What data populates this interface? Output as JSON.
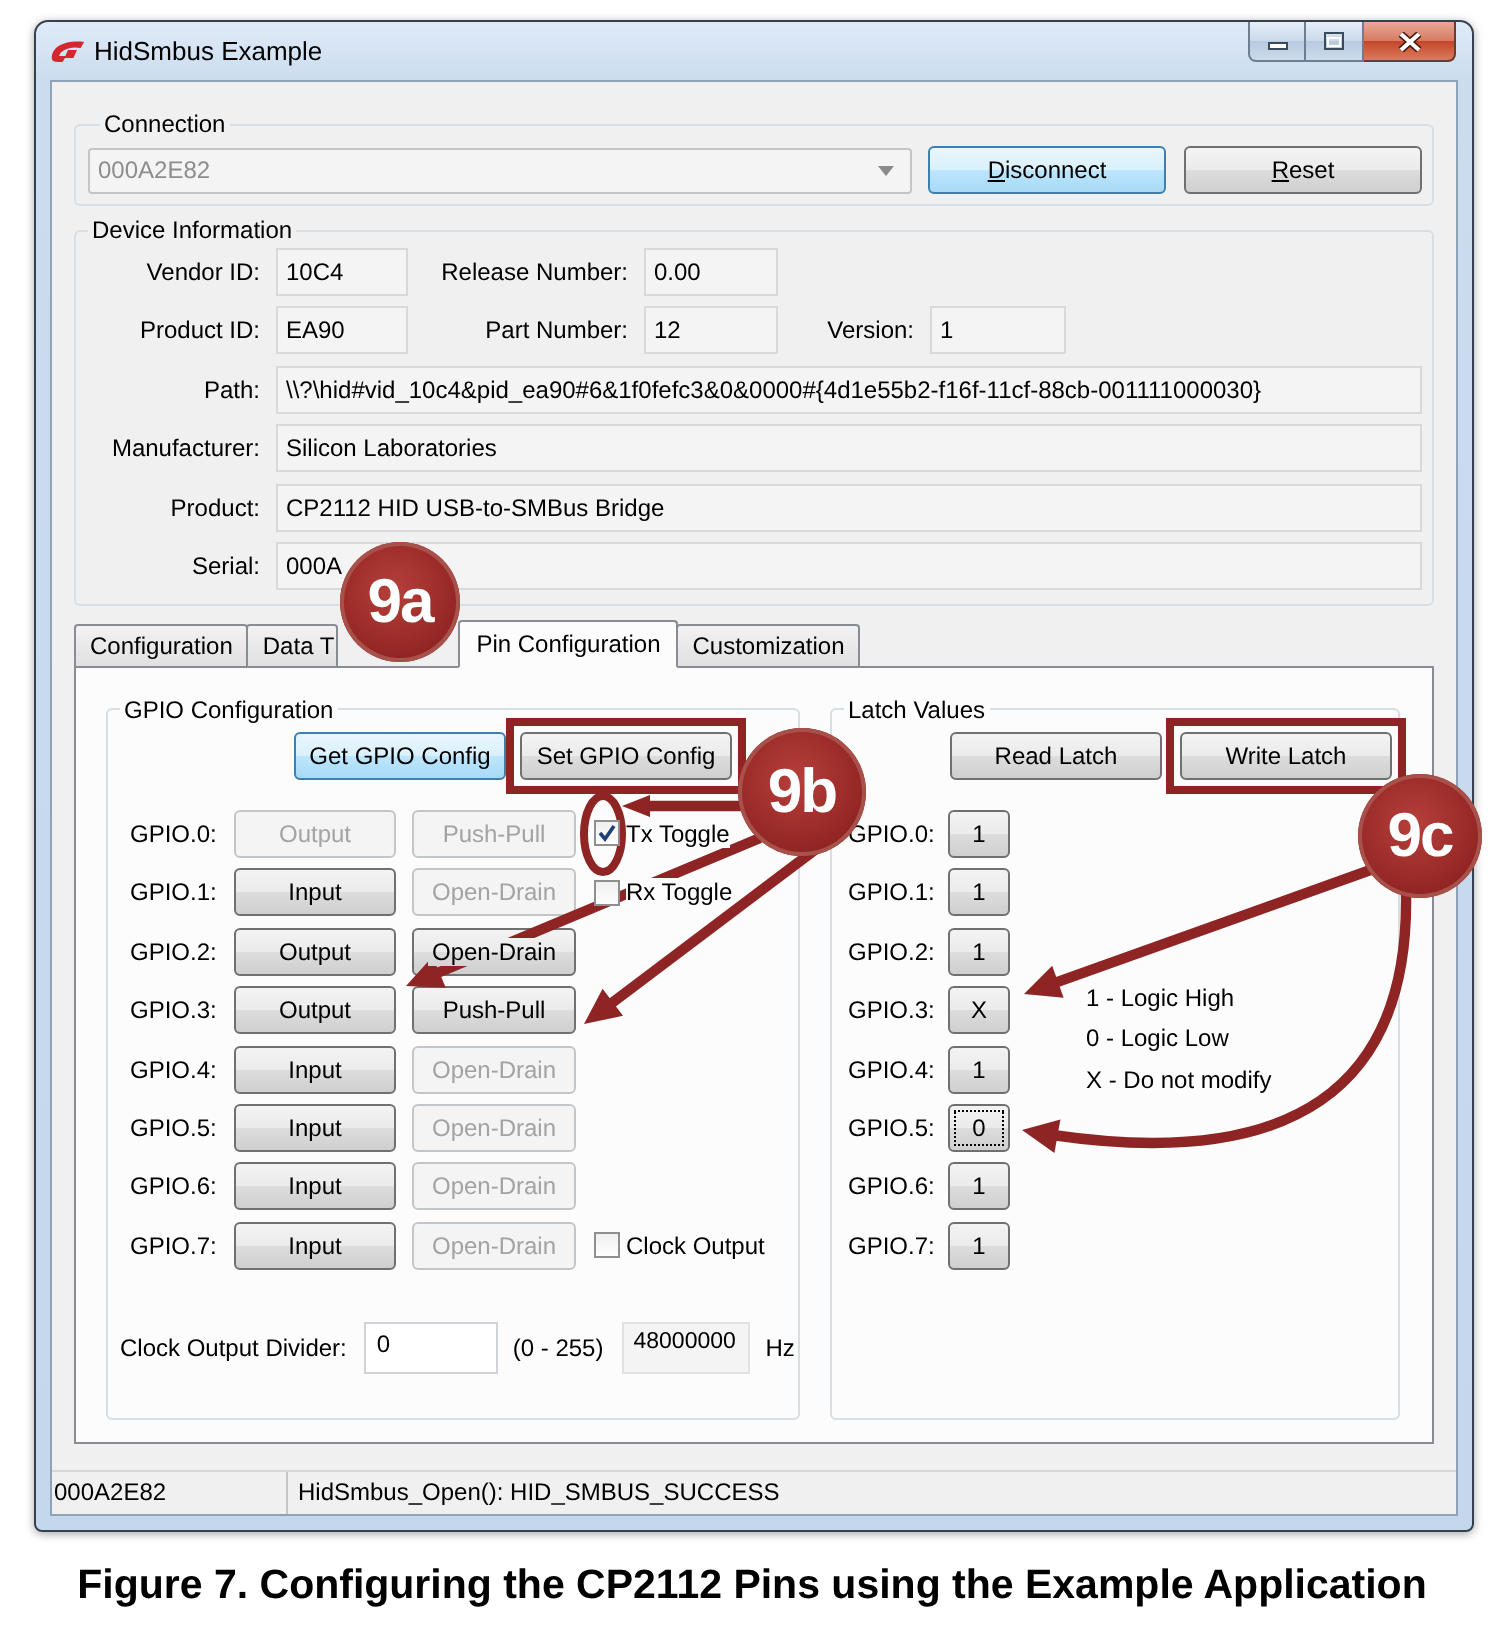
{
  "window": {
    "title": "HidSmbus Example"
  },
  "connection": {
    "title": "Connection",
    "device": {
      "value": "000A2E82",
      "disabled": true
    },
    "buttons": [
      {
        "label": "Disconnect",
        "focused": true
      },
      {
        "label": "Reset",
        "focused": false
      }
    ]
  },
  "device_info": {
    "title": "Device Information",
    "rows": [
      [
        {
          "label": "Vendor ID:",
          "value": "10C4"
        },
        {
          "label": "Release Number:",
          "value": "0.00"
        }
      ],
      [
        {
          "label": "Product ID:",
          "value": "EA90"
        },
        {
          "label": "Part Number:",
          "value": "12"
        },
        {
          "label": "Version:",
          "value": "1"
        }
      ],
      [
        {
          "label": "Path:",
          "value": "\\\\?\\hid#vid_10c4&pid_ea90#6&1f0fefc3&0&0000#{4d1e55b2-f16f-11cf-88cb-001111000030}"
        }
      ],
      [
        {
          "label": "Manufacturer:",
          "value": "Silicon Laboratories"
        }
      ],
      [
        {
          "label": "Product:",
          "value": "CP2112 HID USB-to-SMBus Bridge"
        }
      ],
      [
        {
          "label": "Serial:",
          "value": "000A"
        }
      ]
    ]
  },
  "tabs": [
    {
      "label": "Configuration",
      "selected": false
    },
    {
      "label": "Data T",
      "selected": false
    },
    {
      "label": "Pin Configuration",
      "selected": true
    },
    {
      "label": "Customization",
      "selected": false
    }
  ],
  "gpio_config": {
    "title": "GPIO Configuration",
    "buttons": [
      {
        "label": "Get GPIO Config",
        "focused": true,
        "highlighted": false
      },
      {
        "label": "Set GPIO Config",
        "focused": false,
        "highlighted": true
      }
    ],
    "pins": [
      {
        "label": "GPIO.0:",
        "direction": {
          "label": "Output",
          "disabled": true
        },
        "mode": {
          "label": "Push-Pull",
          "disabled": true
        },
        "option": {
          "label": "Tx Toggle",
          "checked": true,
          "circled": true
        }
      },
      {
        "label": "GPIO.1:",
        "direction": {
          "label": "Input",
          "disabled": false
        },
        "mode": {
          "label": "Open-Drain",
          "disabled": true
        },
        "option": {
          "label": "Rx Toggle",
          "checked": false,
          "circled": false
        }
      },
      {
        "label": "GPIO.2:",
        "direction": {
          "label": "Output",
          "disabled": false
        },
        "mode": {
          "label": "Open-Drain",
          "disabled": false
        }
      },
      {
        "label": "GPIO.3:",
        "direction": {
          "label": "Output",
          "disabled": false
        },
        "mode": {
          "label": "Push-Pull",
          "disabled": false
        }
      },
      {
        "label": "GPIO.4:",
        "direction": {
          "label": "Input",
          "disabled": false
        },
        "mode": {
          "label": "Open-Drain",
          "disabled": true
        }
      },
      {
        "label": "GPIO.5:",
        "direction": {
          "label": "Input",
          "disabled": false
        },
        "mode": {
          "label": "Open-Drain",
          "disabled": true
        }
      },
      {
        "label": "GPIO.6:",
        "direction": {
          "label": "Input",
          "disabled": false
        },
        "mode": {
          "label": "Open-Drain",
          "disabled": true
        }
      },
      {
        "label": "GPIO.7:",
        "direction": {
          "label": "Input",
          "disabled": false
        },
        "mode": {
          "label": "Open-Drain",
          "disabled": true
        },
        "option": {
          "label": "Clock Output",
          "checked": false,
          "circled": false
        }
      }
    ],
    "clock_divider": {
      "label": "Clock Output Divider:",
      "value": "0",
      "range": "(0 - 255)",
      "frequency": "48000000",
      "unit": "Hz"
    }
  },
  "latch": {
    "title": "Latch Values",
    "buttons": [
      {
        "label": "Read Latch",
        "highlighted": false
      },
      {
        "label": "Write Latch",
        "highlighted": true
      }
    ],
    "pins": [
      {
        "label": "GPIO.0:",
        "value": "1",
        "focused": false
      },
      {
        "label": "GPIO.1:",
        "value": "1",
        "focused": false
      },
      {
        "label": "GPIO.2:",
        "value": "1",
        "focused": false
      },
      {
        "label": "GPIO.3:",
        "value": "X",
        "focused": false
      },
      {
        "label": "GPIO.4:",
        "value": "1",
        "focused": false
      },
      {
        "label": "GPIO.5:",
        "value": "0",
        "focused": true
      },
      {
        "label": "GPIO.6:",
        "value": "1",
        "focused": false
      },
      {
        "label": "GPIO.7:",
        "value": "1",
        "focused": false
      }
    ],
    "legend": [
      "1 - Logic High",
      "0 - Logic Low",
      "X - Do not modify"
    ]
  },
  "status_bar": {
    "device": "000A2E82",
    "message": "HidSmbus_Open(): HID_SMBUS_SUCCESS"
  },
  "callouts": [
    {
      "label": "9a"
    },
    {
      "label": "9b"
    },
    {
      "label": "9c"
    }
  ],
  "caption": "Figure 7. Configuring the CP2112 Pins using the Example Application"
}
